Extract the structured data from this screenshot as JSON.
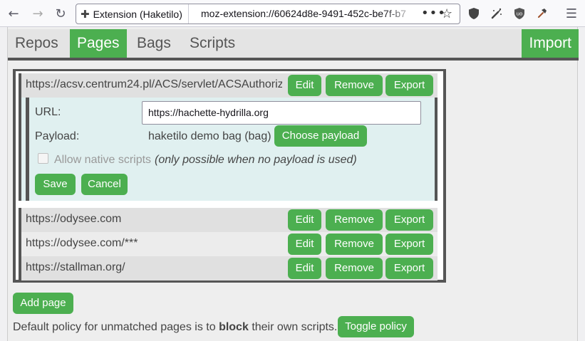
{
  "browser": {
    "back_icon": "arrow-left-icon",
    "forward_icon": "arrow-right-icon",
    "reload_icon": "reload-icon",
    "extension_label": "Extension (Haketilo)",
    "url": "moz-extension://60624d8e-9491-452c-be7f-b7",
    "toolbar_icons": [
      "shield-icon",
      "clean-icon",
      "ublock-icon",
      "hammer-icon",
      "menu-icon"
    ]
  },
  "nav": {
    "tabs": [
      {
        "label": "Repos"
      },
      {
        "label": "Pages"
      },
      {
        "label": "Bags"
      },
      {
        "label": "Scripts"
      }
    ],
    "active_tab": "Pages",
    "import_label": "Import"
  },
  "pages": {
    "rows": [
      {
        "url": "https://acsv.centrum24.pl/ACS/servlet/ACSAuthoriz"
      },
      {
        "url": "https://odysee.com"
      },
      {
        "url": "https://odysee.com/***"
      },
      {
        "url": "https://stallman.org/"
      }
    ],
    "row_buttons": {
      "edit": "Edit",
      "remove": "Remove",
      "export": "Export"
    },
    "editor": {
      "url_label": "URL:",
      "url_value": "https://hachette-hydrilla.org",
      "payload_label": "Payload:",
      "payload_value": "haketilo demo bag (bag)",
      "choose_payload": "Choose payload",
      "allow_native_label": "Allow native scripts",
      "allow_native_note": "(only possible when no payload is used)",
      "save": "Save",
      "cancel": "Cancel"
    }
  },
  "add_page": "Add page",
  "policy": {
    "prefix": "Default policy for unmatched pages is to",
    "action": "block",
    "suffix": "their own scripts.",
    "toggle": "Toggle policy"
  },
  "colors": {
    "accent": "#4caf50",
    "dark_border": "#555555",
    "editor_bg": "#e0f0f0"
  }
}
